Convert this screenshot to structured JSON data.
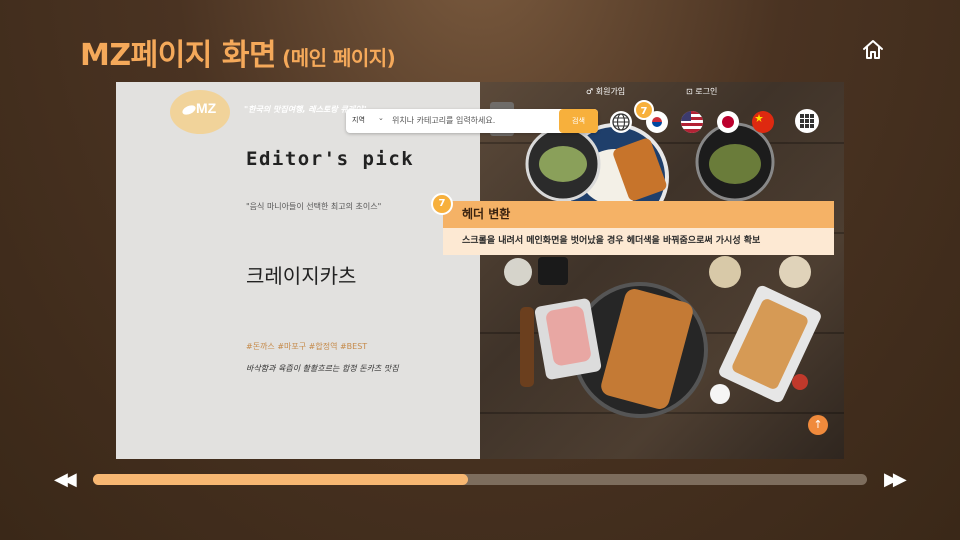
{
  "slide": {
    "title": "MZ페이지 화면",
    "subtitle": "(메인 페이지)"
  },
  "header": {
    "logo_text": "MZ",
    "tagline": "\"한국의 맛집여행, 레스토랑 큐레이\"",
    "search": {
      "region_label": "지역",
      "placeholder": "위치나 카테고리를 입력하세요.",
      "button_label": "검색"
    },
    "links": {
      "signup": "회원가입",
      "login": "로그인"
    }
  },
  "content": {
    "section_title": "Editor's pick",
    "section_subtitle": "\"음식 마니아들이 선택한 최고의 초이스\"",
    "restaurant_name": "크레이지카츠",
    "tags": "#돈까스 #마포구 #합정역 #BEST",
    "description": "바삭함과 육즙이 촬촬흐르는 합정 돈카츠 맛집"
  },
  "annotation": {
    "number": "7",
    "title": "헤더 변환",
    "body": "스크롤을 내려서 메인화면을 벗어났을 경우 헤더색을 바꿔줌으로써 가시성 확보"
  },
  "icons": {
    "home": "home-icon",
    "globe": "globe-icon",
    "grid": "grid-menu-icon",
    "scroll_top": "arrow-up-icon",
    "prev": "rewind-icon",
    "next": "fast-forward-icon"
  },
  "player": {
    "progress": 0.485
  },
  "colors": {
    "accent": "#f5a95a",
    "badge": "#f7b03c",
    "callout_head": "#f5b266",
    "callout_body": "#fde9d3"
  }
}
